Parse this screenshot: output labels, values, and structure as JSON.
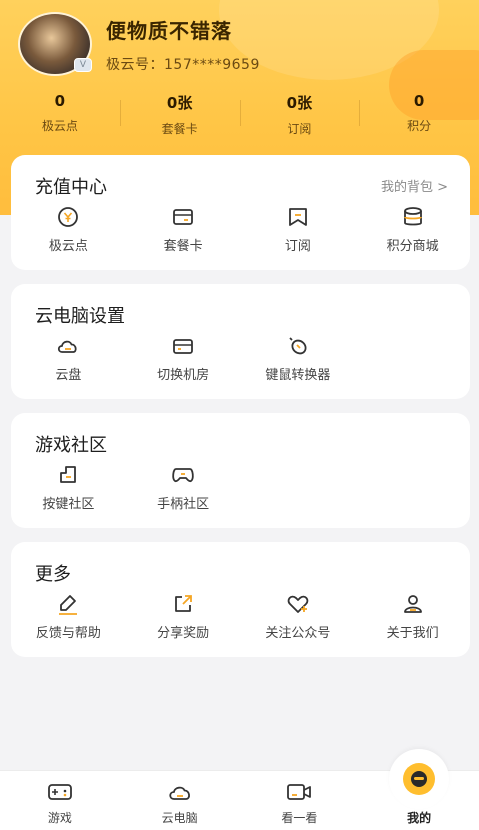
{
  "profile": {
    "username": "便物质不错落",
    "user_id": "极云号：157****9659",
    "vip_badge": "V"
  },
  "stats": [
    {
      "value": "0",
      "label": "极云点"
    },
    {
      "value": "0张",
      "label": "套餐卡"
    },
    {
      "value": "0张",
      "label": "订阅"
    },
    {
      "value": "0",
      "label": "积分"
    }
  ],
  "recharge": {
    "title": "充值中心",
    "link": "我的背包 >",
    "items": [
      {
        "label": "极云点",
        "icon": "yen-coin-icon"
      },
      {
        "label": "套餐卡",
        "icon": "card-icon"
      },
      {
        "label": "订阅",
        "icon": "bookmark-icon"
      },
      {
        "label": "积分商城",
        "icon": "coins-stack-icon"
      }
    ]
  },
  "cloud_settings": {
    "title": "云电脑设置",
    "items": [
      {
        "label": "云盘",
        "icon": "cloud-icon"
      },
      {
        "label": "切换机房",
        "icon": "server-icon"
      },
      {
        "label": "键鼠转换器",
        "icon": "mouse-icon"
      }
    ]
  },
  "community": {
    "title": "游戏社区",
    "items": [
      {
        "label": "按键社区",
        "icon": "keyboard-key-icon"
      },
      {
        "label": "手柄社区",
        "icon": "gamepad-icon"
      }
    ]
  },
  "more": {
    "title": "更多",
    "items": [
      {
        "label": "反馈与帮助",
        "icon": "pencil-icon"
      },
      {
        "label": "分享奖励",
        "icon": "share-icon"
      },
      {
        "label": "关注公众号",
        "icon": "heart-plus-icon"
      },
      {
        "label": "关于我们",
        "icon": "person-icon"
      }
    ]
  },
  "tabbar": [
    {
      "label": "游戏",
      "icon": "game-controller-icon"
    },
    {
      "label": "云电脑",
      "icon": "cloud-icon"
    },
    {
      "label": "看一看",
      "icon": "video-camera-icon"
    },
    {
      "label": "我的",
      "icon": "mine-face-icon",
      "active": true
    }
  ],
  "colors": {
    "accent": "#ffbe2e",
    "header_top": "#ffd15c",
    "icon_stroke": "#333333",
    "icon_accent": "#f5a623"
  }
}
